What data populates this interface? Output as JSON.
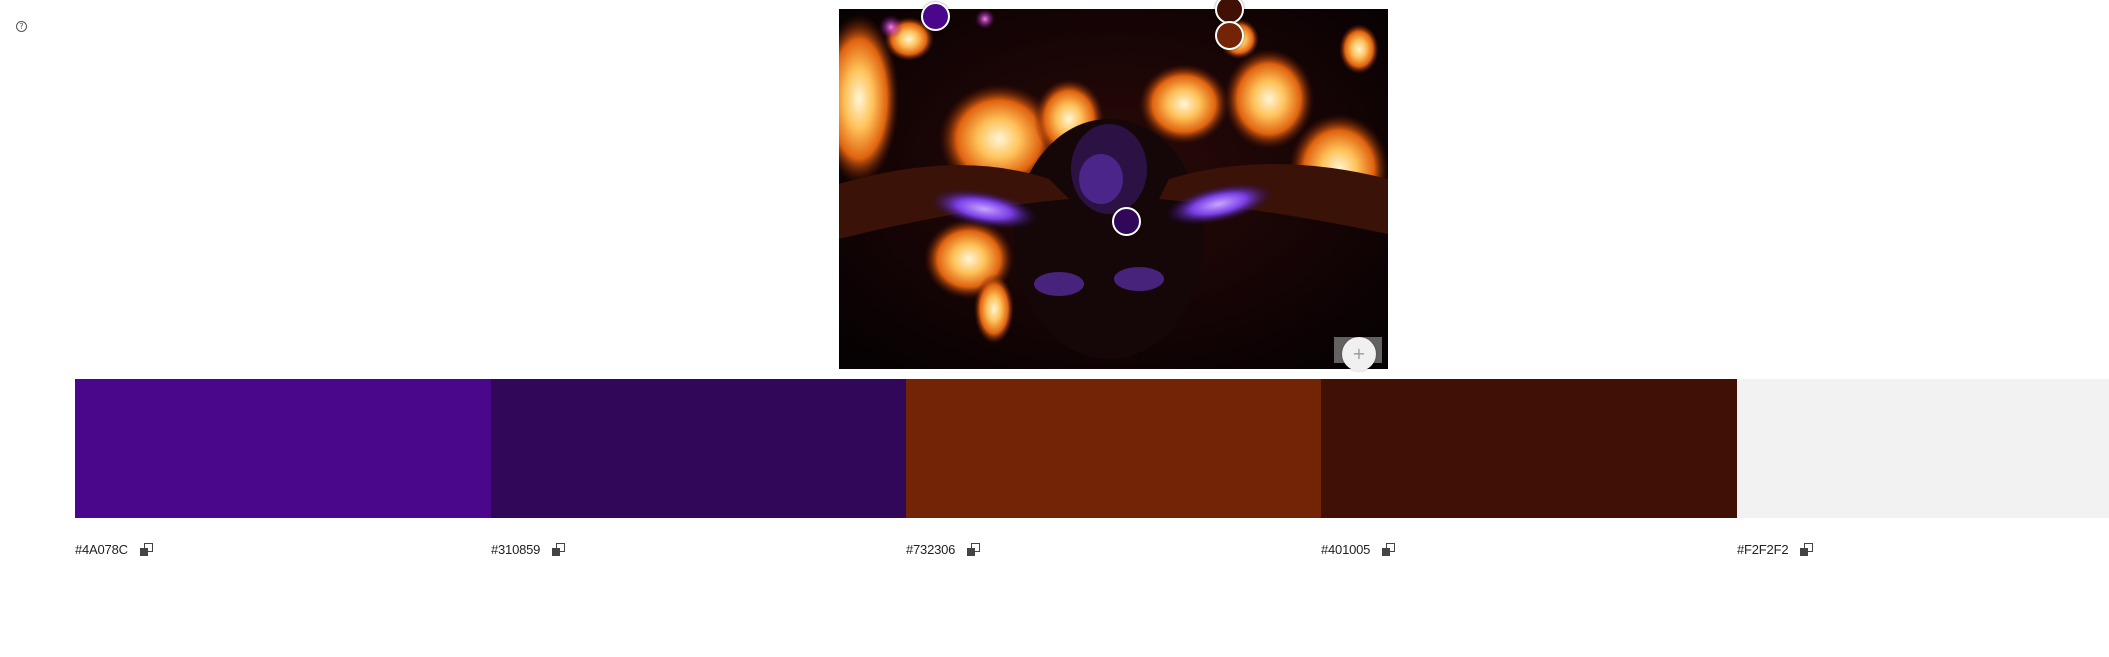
{
  "help": {
    "icon": "question-circle-icon",
    "glyph": "?"
  },
  "photo": {
    "description_icon": "fire-performer-photo"
  },
  "samplers": [
    {
      "color": "#4A078C"
    },
    {
      "color": "#401005"
    },
    {
      "color": "#732306"
    },
    {
      "color": "#310859"
    }
  ],
  "add_button": {
    "glyph": "+"
  },
  "palette": [
    {
      "hex": "#4A078C",
      "label": "#4A078C"
    },
    {
      "hex": "#310859",
      "label": "#310859"
    },
    {
      "hex": "#732306",
      "label": "#732306"
    },
    {
      "hex": "#401005",
      "label": "#401005"
    },
    {
      "hex": "#F2F2F2",
      "label": "#F2F2F2"
    }
  ]
}
